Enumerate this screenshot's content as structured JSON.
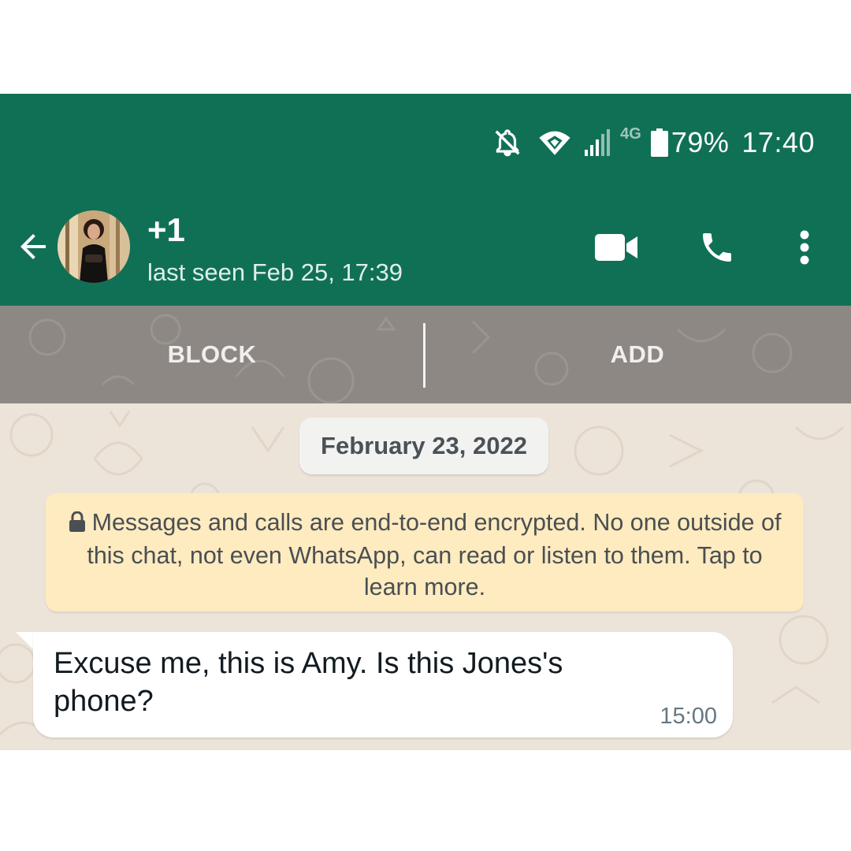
{
  "status_bar": {
    "network": "4G",
    "battery": "79%",
    "time": "17:40"
  },
  "header": {
    "contact_name": "+1",
    "contact_status": "last seen Feb 25, 17:39"
  },
  "actions": {
    "block_label": "BLOCK",
    "add_label": "ADD"
  },
  "chat": {
    "date_chip": "February 23, 2022",
    "encryption_notice": "Messages and calls are end-to-end encrypted. No one outside of this chat, not even WhatsApp, can read or listen to them. Tap to learn more.",
    "messages": [
      {
        "text": "Excuse me, this is Amy. Is this Jones's phone?",
        "time": "15:00",
        "direction": "incoming"
      }
    ]
  },
  "colors": {
    "header_bg": "#107056",
    "action_bar_bg": "#8d8883",
    "chat_bg": "#ece4d9",
    "notice_bg": "#feebc0",
    "bubble_bg": "#ffffff"
  },
  "icons": {
    "status": [
      "bell-off-icon",
      "wifi-icon",
      "signal-icon",
      "battery-icon"
    ],
    "header": [
      "back-arrow-icon",
      "video-call-icon",
      "phone-icon",
      "more-vert-icon"
    ],
    "notice": "lock-icon"
  }
}
